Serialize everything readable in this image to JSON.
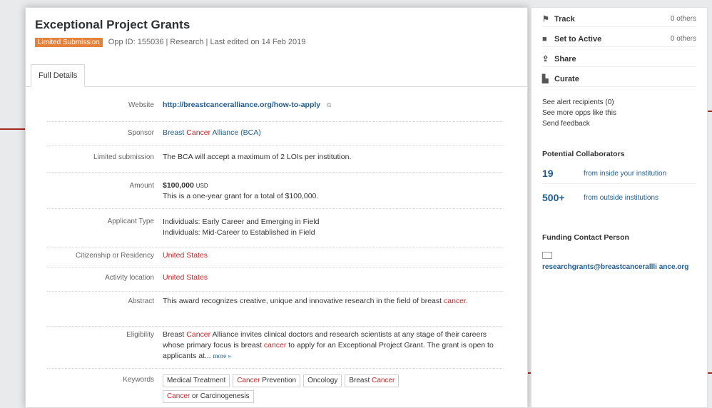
{
  "page": {
    "title": "Exceptional Project Grants",
    "badge": "Limited Submission",
    "meta": "Opp ID: 155036  |  Research  |  Last edited on 14 Feb 2019",
    "tab": "Full Details"
  },
  "details": {
    "website": {
      "label": "Website",
      "value": "http://breastcanceralliance.org/how-to-apply"
    },
    "sponsor": {
      "label": "Sponsor",
      "value_pre": "Breast ",
      "value_red": "Cancer",
      "value_post": " Alliance (BCA)"
    },
    "limited": {
      "label": "Limited submission",
      "value": "The BCA will accept a maximum of 2 LOIs per institution."
    },
    "amount": {
      "label": "Amount",
      "value": "$100,000",
      "currency": "USD",
      "note": "This is a one-year grant for a total of $100,000."
    },
    "applicant": {
      "label": "Applicant Type",
      "line1": "Individuals: Early Career and Emerging in Field",
      "line2": "Individuals: Mid-Career to Established in Field"
    },
    "citizenship": {
      "label": "Citizenship or Residency",
      "value": "United States"
    },
    "activity": {
      "label": "Activity location",
      "value": "United States"
    },
    "abstract": {
      "label": "Abstract",
      "text_pre": "This award recognizes creative, unique and innovative research in the field of breast ",
      "text_red": "cancer",
      "text_post": "."
    },
    "eligibility": {
      "label": "Eligibility",
      "p1": "Breast ",
      "r1": "Cancer",
      "p2": " Alliance invites clinical doctors and research scientists at any stage of their careers whose primary focus is breast ",
      "r2": "cancer",
      "p3": " to apply for an Exceptional Project Grant. The grant is open to applicants at...",
      "more": "more »"
    },
    "keywords": {
      "label": "Keywords",
      "k1": "Medical Treatment",
      "k2_red": "Cancer",
      "k2_post": " Prevention",
      "k3": "Oncology",
      "k4_pre": "Breast ",
      "k4_red": "Cancer",
      "k5_red": "Cancer",
      "k5_post": " or Carcinogenesis"
    }
  },
  "sidebar": {
    "track": {
      "label": "Track",
      "count": "0 others"
    },
    "set_active": {
      "label": "Set to Active",
      "count": "0 others"
    },
    "share": {
      "label": "Share"
    },
    "curate": {
      "label": "Curate"
    },
    "links": {
      "alert": "See alert recipients  (0)",
      "more_opps": "See more opps like this",
      "feedback": "Send feedback"
    },
    "collab_heading": "Potential Collaborators",
    "collab_inside": {
      "num": "19",
      "text": "from inside your institution"
    },
    "collab_outside": {
      "num": "500+",
      "text": "from outside institutions"
    },
    "contact_heading": "Funding Contact Person",
    "contact_email": "researchgrants@breastcancerallli ance.org"
  },
  "colors": {
    "accent_red": "#c0282b",
    "link_blue": "#1f5b8d",
    "badge_orange": "#e5813b"
  }
}
